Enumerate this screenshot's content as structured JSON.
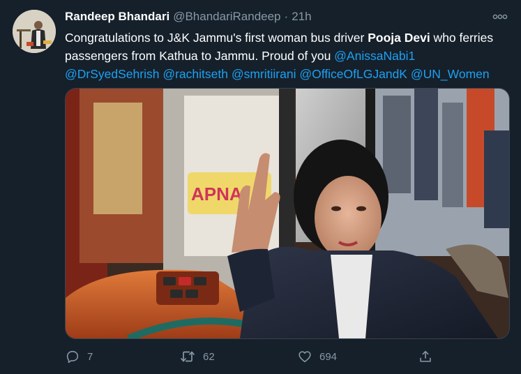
{
  "tweet": {
    "author": {
      "display_name": "Randeep Bhandari",
      "handle": "@BhandariRandeep",
      "separator": "·",
      "time": "21h"
    },
    "more_label": "ooo",
    "text": {
      "part1": "Congratulations to J&K  Jammu's first woman bus driver ",
      "bold_name": "Pooja Devi",
      "part2": " who ferries passengers from Kathua to Jammu. Proud of you ",
      "mentions": [
        "@AnissaNabi1",
        "@DrSyedSehrish",
        "@rachitseth",
        "@smritiirani",
        "@OfficeOfLGJandK",
        "@UN_Women"
      ]
    },
    "media": {
      "sign_text": "APNA"
    },
    "actions": {
      "replies": "7",
      "retweets": "62",
      "likes": "694"
    }
  },
  "colors": {
    "background": "#15202b",
    "text": "#ffffff",
    "muted": "#8899a6",
    "link": "#1da1f2"
  },
  "icons": [
    "reply-icon",
    "retweet-icon",
    "like-icon",
    "share-icon",
    "more-icon"
  ]
}
